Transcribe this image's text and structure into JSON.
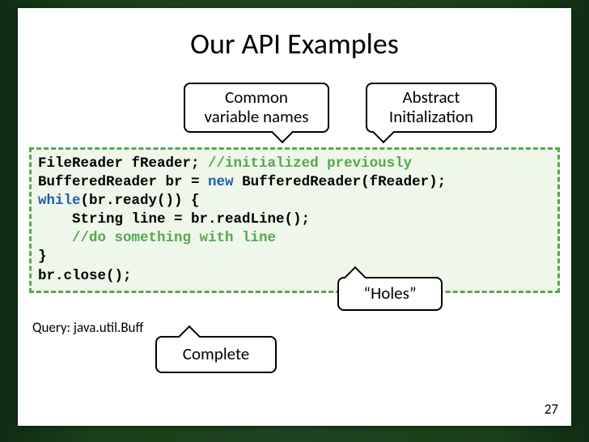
{
  "slide": {
    "title": "Our API Examples",
    "callouts": {
      "common": {
        "line1": "Common",
        "line2": "variable names"
      },
      "abstract": {
        "line1": "Abstract",
        "line2": "Initialization"
      },
      "holes": {
        "text": "“Holes”"
      },
      "complete": {
        "text": "Complete"
      }
    },
    "code": {
      "l1a": "FileReader fReader; ",
      "l1b": "//initialized previously",
      "l2a": "BufferedReader br = ",
      "l2b": "new",
      "l2c": " BufferedReader(fReader);",
      "l3a": "while",
      "l3b": "(br.ready()) {",
      "l4": "    String line = br.readLine();",
      "l5": "    //do something with line",
      "l6": "}",
      "l7": "br.close();"
    },
    "query_label": "Query: java.util.Buff",
    "page_number": "27"
  }
}
